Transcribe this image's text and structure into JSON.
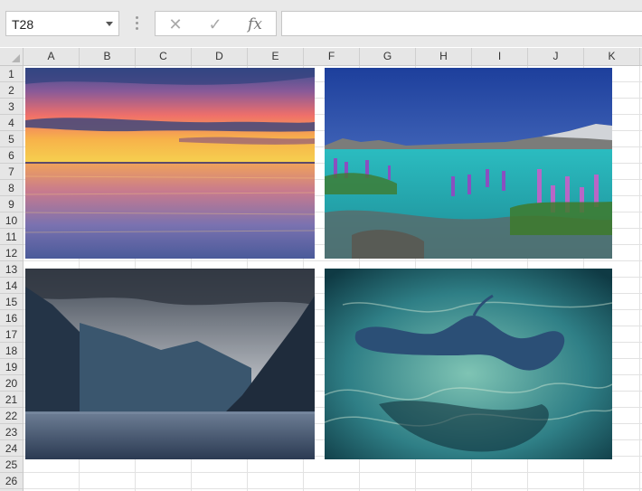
{
  "formula_bar": {
    "name_box": "T28",
    "cancel_icon": "close-icon",
    "enter_icon": "check-icon",
    "function_label": "fx",
    "formula": ""
  },
  "columns": [
    "A",
    "B",
    "C",
    "D",
    "E",
    "F",
    "G",
    "H",
    "I",
    "J",
    "K"
  ],
  "rows": [
    "1",
    "2",
    "3",
    "4",
    "5",
    "6",
    "7",
    "8",
    "9",
    "10",
    "11",
    "12",
    "13",
    "14",
    "15",
    "16",
    "17",
    "18",
    "19",
    "20",
    "21",
    "22",
    "23",
    "24",
    "25",
    "26"
  ],
  "pictures": [
    {
      "name": "sunset-over-water-picture"
    },
    {
      "name": "mountain-lake-with-lupins-picture"
    },
    {
      "name": "fjord-picture"
    },
    {
      "name": "stingray-underwater-picture"
    }
  ]
}
